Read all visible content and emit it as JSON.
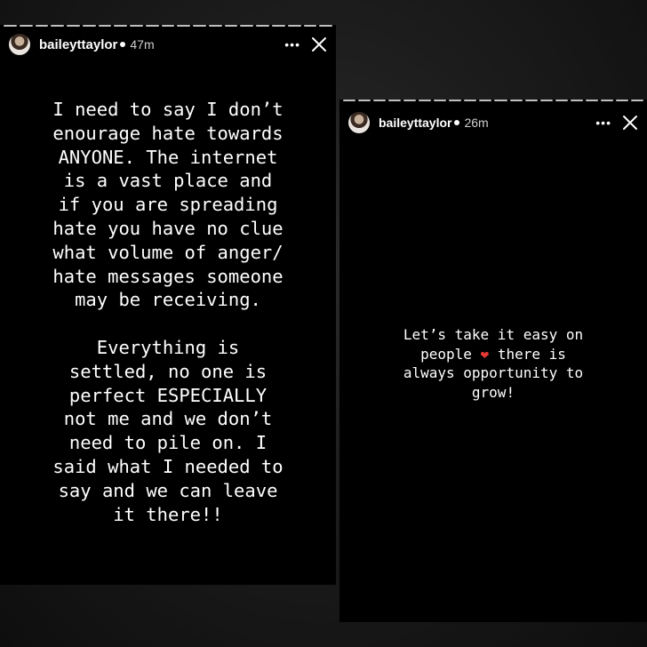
{
  "stories": [
    {
      "username": "baileyttaylor",
      "time": "47m",
      "more_icon": "more-horizontal-icon",
      "close_icon": "close-icon",
      "text": "I need to say I don’t\nenourage hate towards\nANYONE. The internet\nis a vast place and\nif you are spreading\nhate you have no clue\nwhat volume of anger/\nhate messages someone\nmay be receiving.\n\nEverything is\nsettled, no one is\nperfect ESPECIALLY\nnot me and we don’t\nneed to pile on. I\nsaid what I needed to\nsay and we can leave\nit there!!"
    },
    {
      "username": "baileyttaylor",
      "time": "26m",
      "more_icon": "more-horizontal-icon",
      "close_icon": "close-icon",
      "text_before": "Let’s take it easy on\npeople ",
      "heart": "❤",
      "text_after": " there is\nalways opportunity to\ngrow!"
    }
  ],
  "colors": {
    "background": "#000000",
    "text": "#ffffff",
    "heart": "#e53935"
  }
}
